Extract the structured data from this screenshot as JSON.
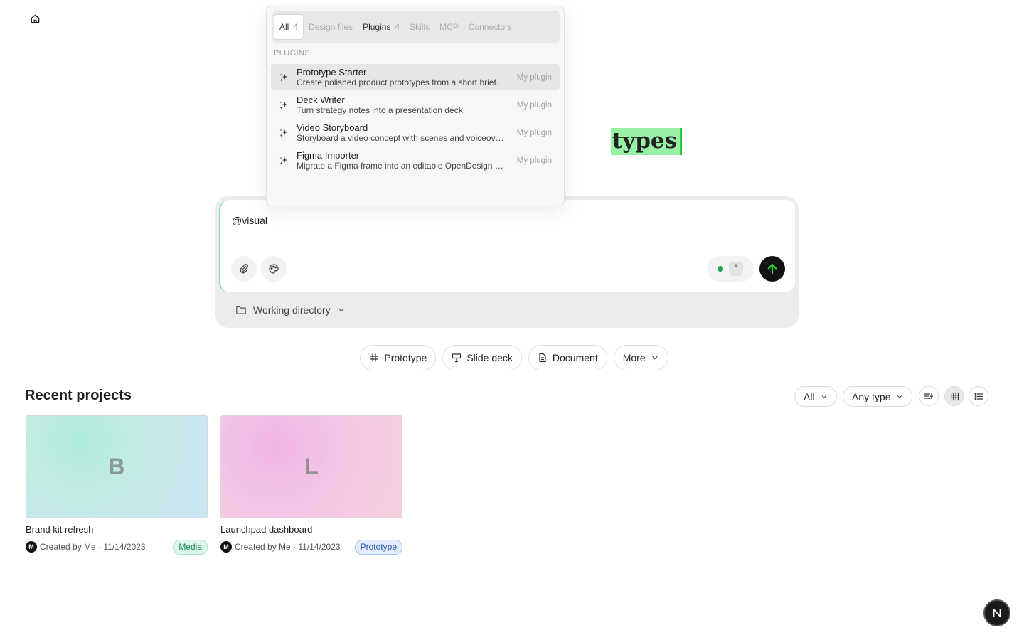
{
  "hero": {
    "title_highlight": "types"
  },
  "composer": {
    "input_value": "@visual",
    "model_badge": "M",
    "working_directory": "Working directory"
  },
  "popover": {
    "tabs": [
      {
        "label": "All",
        "count": "4"
      },
      {
        "label": "Design files",
        "count": ""
      },
      {
        "label": "Plugins",
        "count": "4"
      },
      {
        "label": "Skills",
        "count": ""
      },
      {
        "label": "MCP",
        "count": ""
      },
      {
        "label": "Connectors",
        "count": ""
      }
    ],
    "section_label": "PLUGINS",
    "plugins": [
      {
        "name": "Prototype Starter",
        "description": "Create polished product prototypes from a short brief.",
        "kind": "My plugin"
      },
      {
        "name": "Deck Writer",
        "description": "Turn strategy notes into a presentation deck.",
        "kind": "My plugin"
      },
      {
        "name": "Video Storyboard",
        "description": "Storyboard a video concept with scenes and voiceover.",
        "kind": "My plugin"
      },
      {
        "name": "Figma Importer",
        "description": "Migrate a Figma frame into an editable OpenDesign project.",
        "kind": "My plugin"
      }
    ]
  },
  "quick_actions": {
    "prototype": "Prototype",
    "slide_deck": "Slide deck",
    "document": "Document",
    "more": "More"
  },
  "recent": {
    "title": "Recent projects",
    "filter_scope": "All",
    "filter_type": "Any type",
    "projects": [
      {
        "initial": "B",
        "name": "Brand kit refresh",
        "avatar": "M",
        "meta": "Created by Me · 11/14/2023",
        "tag": "Media"
      },
      {
        "initial": "L",
        "name": "Launchpad dashboard",
        "avatar": "M",
        "meta": "Created by Me · 11/14/2023",
        "tag": "Prototype"
      }
    ]
  },
  "fab_letter": "N",
  "colors": {
    "accent_green": "#97f2a5",
    "send_arrow": "#22d63a",
    "tag_media": "#178559",
    "tag_prototype": "#2458b4"
  },
  "icons": [
    "home-icon",
    "paperclip-icon",
    "palette-icon",
    "arrow-up-icon",
    "folder-icon",
    "chevron-down-icon",
    "hash-icon",
    "presentation-icon",
    "document-icon",
    "sparkles-icon",
    "sort-icon",
    "grid-icon",
    "list-icon"
  ]
}
